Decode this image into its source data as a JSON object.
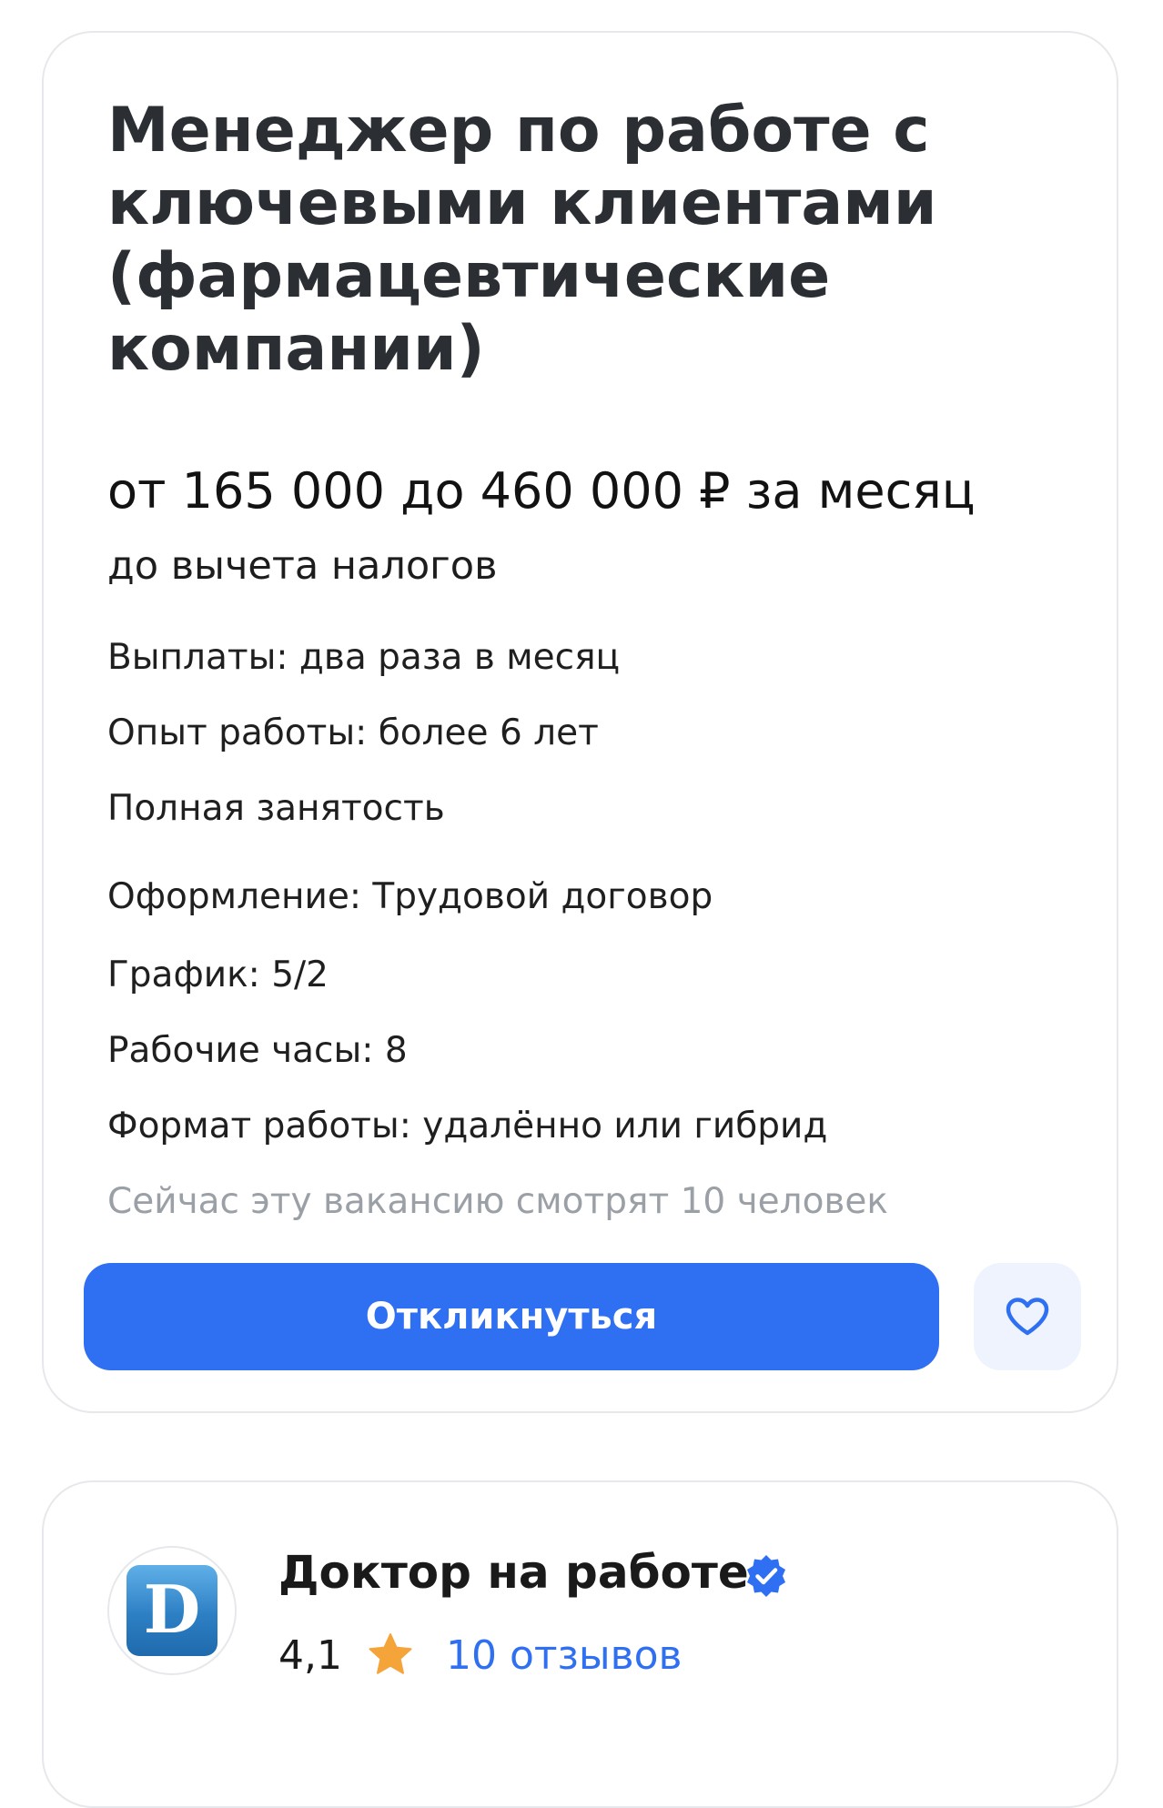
{
  "vacancy": {
    "title": "Менеджер по работе с ключевыми клиентами (фармацевтические компании)",
    "salary": "от 165 000 до 460 000 ₽ за месяц",
    "salary_note": "до вычета налогов",
    "details": [
      "Выплаты: два раза в месяц",
      "Опыт работы: более 6 лет",
      "Полная занятость",
      "Оформление: Трудовой договор",
      "График: 5/2",
      "Рабочие часы: 8",
      "Формат работы: удалённо или гибрид"
    ],
    "viewers": "Сейчас эту вакансию смотрят 10 человек",
    "respond_label": "Откликнуться",
    "favorite_icon": "heart-icon",
    "accent_color": "#2f6ff2"
  },
  "company": {
    "logo_letter": "D",
    "name": "Доктор на работе",
    "verified_icon": "verified-badge-icon",
    "rating": "4,1",
    "rating_icon": "star-icon",
    "reviews_label": "10 отзывов"
  }
}
